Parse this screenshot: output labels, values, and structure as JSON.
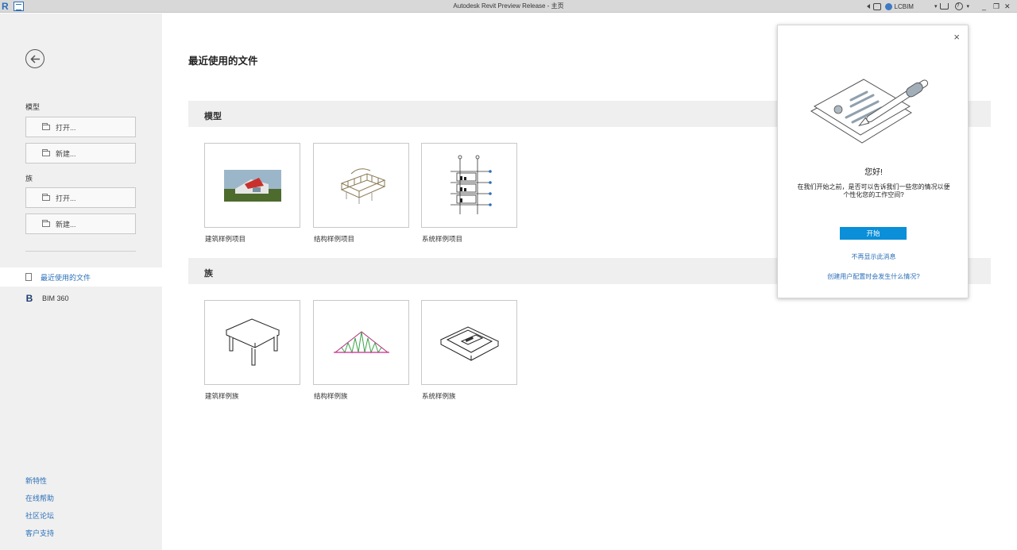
{
  "titlebar": {
    "app_logo": "R",
    "title": "Autodesk Revit Preview Release - 主页",
    "username": "LCBIM"
  },
  "sidebar": {
    "model_label": "模型",
    "model_open": "打开...",
    "model_new": "新建...",
    "family_label": "族",
    "family_open": "打开...",
    "family_new": "新建...",
    "nav": [
      {
        "label": "最近使用的文件",
        "active": true
      },
      {
        "label": "BIM 360",
        "icon_text": "B"
      }
    ],
    "footer_links": [
      "新特性",
      "在线帮助",
      "社区论坛",
      "客户支持"
    ]
  },
  "main": {
    "title": "最近使用的文件",
    "sections": [
      {
        "label": "模型",
        "items": [
          "建筑样例项目",
          "结构样例项目",
          "系统样例项目"
        ]
      },
      {
        "label": "族",
        "items": [
          "建筑样例族",
          "结构样例族",
          "系统样例族"
        ]
      }
    ]
  },
  "popup": {
    "close": "×",
    "greeting": "您好!",
    "message": "在我们开始之前，是否可以告诉我们一些您的情况以便个性化您的工作空间?",
    "start_button": "开始",
    "dismiss_link": "不再显示此消息",
    "info_link": "创建用户配置时会发生什么情况?"
  },
  "colors": {
    "accent": "#0a8fd8",
    "link": "#2b6fb8",
    "sidebar_bg": "#f0f0f0",
    "titlebar_bg": "#d8d8d8"
  }
}
